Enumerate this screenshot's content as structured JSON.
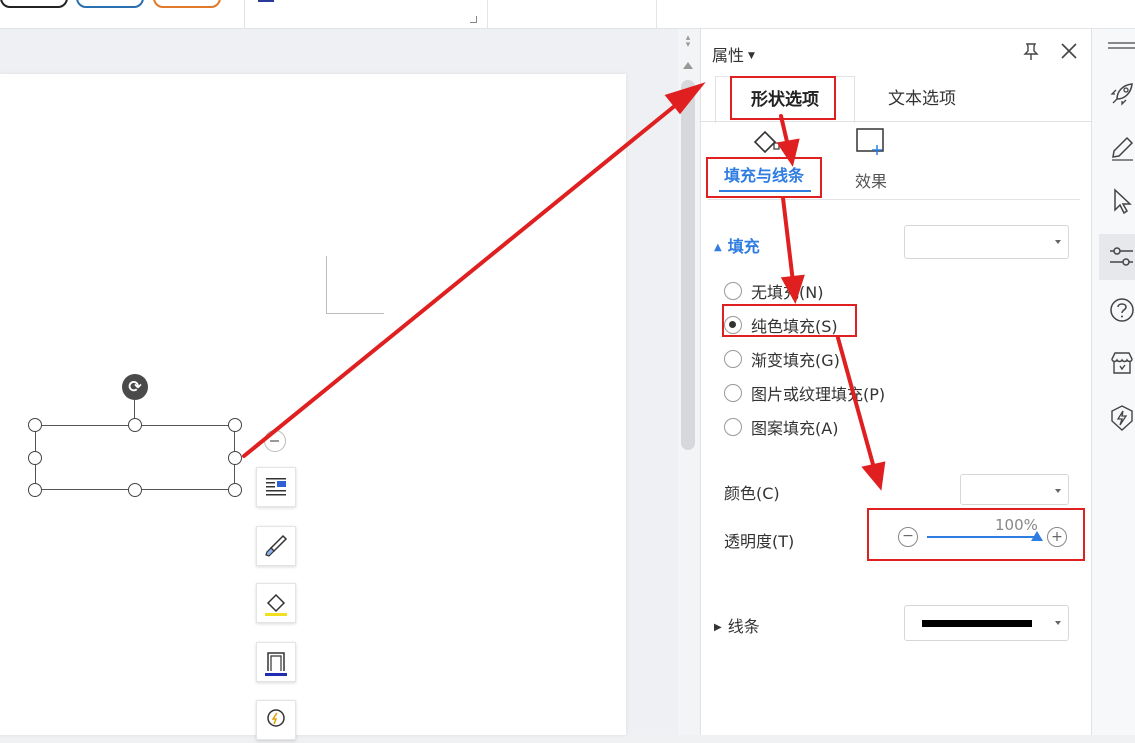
{
  "panel": {
    "title": "属性",
    "tabs": [
      {
        "label": "形状选项",
        "active": true
      },
      {
        "label": "文本选项",
        "active": false
      }
    ],
    "subtabs": [
      {
        "label": "填充与线条",
        "active": true
      },
      {
        "label": "效果",
        "active": false
      }
    ],
    "fill_section": {
      "label": "填充",
      "options": [
        {
          "label": "无填充(N)",
          "selected": false
        },
        {
          "label": "纯色填充(S)",
          "selected": true
        },
        {
          "label": "渐变填充(G)",
          "selected": false
        },
        {
          "label": "图片或纹理填充(P)",
          "selected": false
        },
        {
          "label": "图案填充(A)",
          "selected": false
        }
      ],
      "color_label": "颜色(C)",
      "transparency_label": "透明度(T)",
      "transparency_value": "100%",
      "transparency_fraction": 1.0
    },
    "line_section": {
      "label": "线条"
    }
  },
  "colors": {
    "accent": "#2f7de1",
    "annotation": "#e02020",
    "line_swatch": "#000000"
  },
  "icons": [
    "pin-icon",
    "close-icon",
    "fill-bucket-icon",
    "effects-icon",
    "rocket-icon",
    "pen-icon",
    "cursor-icon",
    "settings-sliders-icon",
    "help-icon",
    "shop-icon",
    "lightning-icon",
    "rotate-icon",
    "text-wrap-icon",
    "brush-icon",
    "fill-color-icon",
    "outline-icon",
    "idea-icon"
  ]
}
